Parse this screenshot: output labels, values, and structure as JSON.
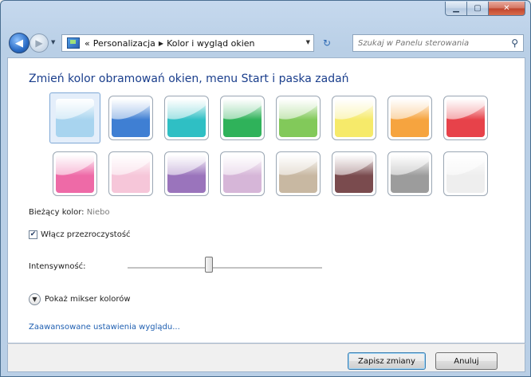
{
  "window": {
    "min_icon": "minimize-icon",
    "max_icon": "maximize-icon",
    "close_icon": "close-icon"
  },
  "nav": {
    "back_icon": "back-arrow-icon",
    "forward_icon": "forward-arrow-icon",
    "history_icon": "chevron-down-icon",
    "path_prefix": "«",
    "crumbs": [
      "Personalizacja",
      "Kolor i wygląd okien"
    ],
    "refresh_icon": "refresh-icon",
    "search_placeholder": "Szukaj w Panelu sterowania",
    "search_icon": "search-icon"
  },
  "main": {
    "heading": "Zmień kolor obramowań okien, menu Start i paska zadań",
    "swatches": [
      {
        "color": "#a8d4ef",
        "selected": true
      },
      {
        "color": "#3f7fd3"
      },
      {
        "color": "#2fbfc4"
      },
      {
        "color": "#2fb25a"
      },
      {
        "color": "#82c95a"
      },
      {
        "color": "#f6ea6a"
      },
      {
        "color": "#f6a43f"
      },
      {
        "color": "#e7424a"
      },
      {
        "color": "#ee6aa7"
      },
      {
        "color": "#f6c6d9"
      },
      {
        "color": "#9a74bc"
      },
      {
        "color": "#d6b6d8"
      },
      {
        "color": "#c8b8a2"
      },
      {
        "color": "#7a4b4e"
      },
      {
        "color": "#9c9c9c"
      },
      {
        "color": "#eeeeee"
      }
    ],
    "current_label": "Bieżący kolor:",
    "current_value": "Niebo",
    "transparency_label": "Włącz przezroczystość",
    "transparency_checked": true,
    "intensity_label": "Intensywność:",
    "intensity_fraction": 0.42,
    "mixer_label": "Pokaż mikser kolorów",
    "advanced_link": "Zaawansowane ustawienia wyglądu..."
  },
  "footer": {
    "save_label": "Zapisz zmiany",
    "cancel_label": "Anuluj"
  }
}
